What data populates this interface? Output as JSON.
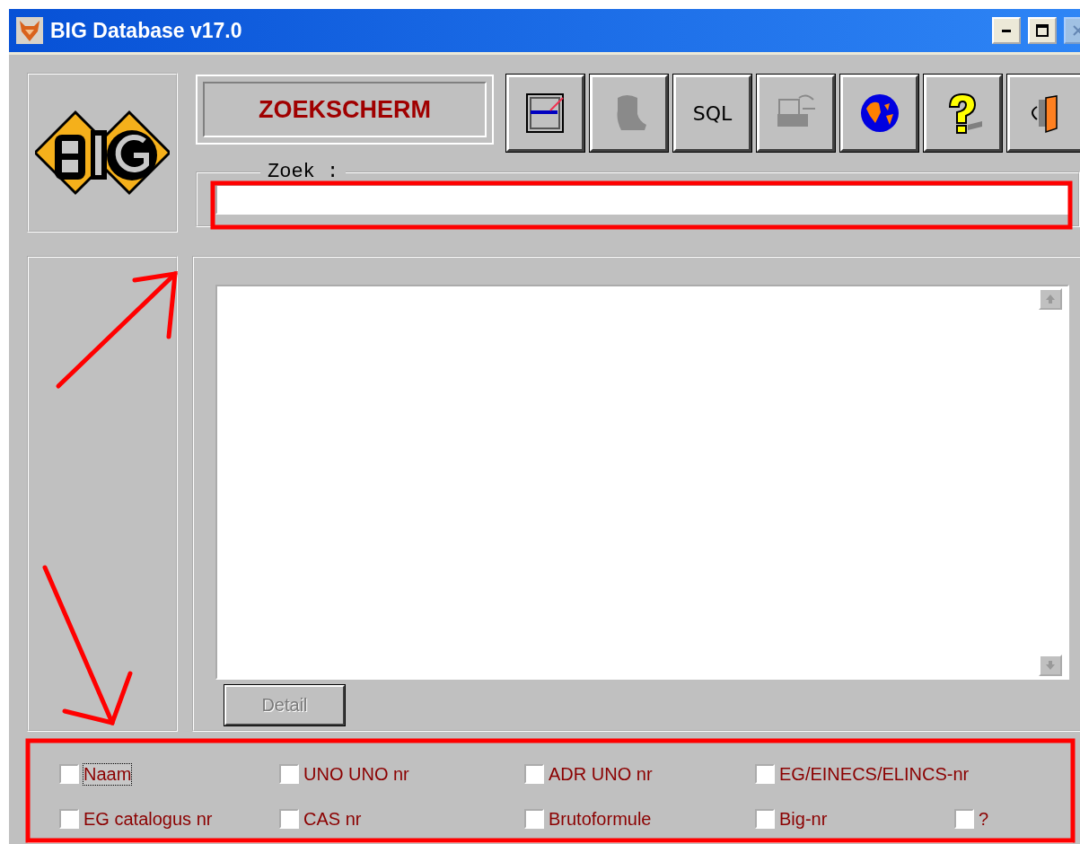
{
  "window": {
    "title": "BIG Database v17.0"
  },
  "header": {
    "label": "ZOEKSCHERM"
  },
  "toolbar": [
    {
      "kind": "window",
      "disabled": false
    },
    {
      "kind": "silhouette",
      "disabled": true
    },
    {
      "kind": "text",
      "label": "SQL",
      "disabled": false
    },
    {
      "kind": "typewriter",
      "disabled": true
    },
    {
      "kind": "globe",
      "disabled": false
    },
    {
      "kind": "help",
      "disabled": false
    },
    {
      "kind": "exit",
      "disabled": false
    }
  ],
  "search": {
    "label": "Zoek :"
  },
  "detail_button": {
    "label": "Detail",
    "disabled": true
  },
  "search_options": [
    [
      {
        "label": "Naam",
        "checked": false,
        "focused": true
      },
      {
        "label": "UNO UNO nr",
        "checked": false,
        "focused": false
      },
      {
        "label": "ADR UNO nr",
        "checked": false,
        "focused": false
      },
      {
        "label": "EG/EINECS/ELINCS-nr",
        "checked": false,
        "focused": false
      }
    ],
    [
      {
        "label": "EG catalogus nr",
        "checked": false,
        "focused": false
      },
      {
        "label": "CAS nr",
        "checked": false,
        "focused": false
      },
      {
        "label": "Brutoformule",
        "checked": false,
        "focused": false
      },
      {
        "label": "Big-nr",
        "checked": false,
        "focused": false
      },
      {
        "label": "?",
        "checked": false,
        "focused": false
      }
    ]
  ]
}
